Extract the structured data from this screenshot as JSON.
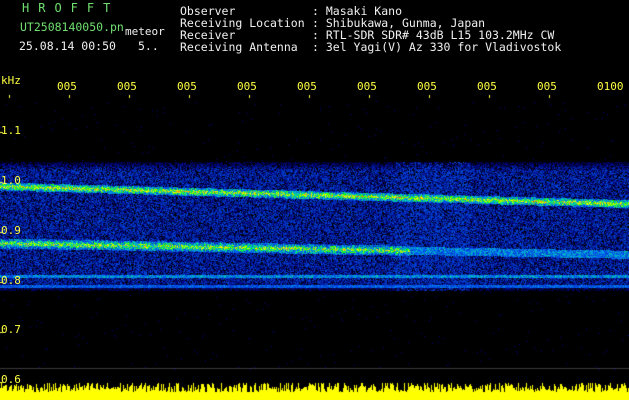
{
  "brand": "HROFFT",
  "file": {
    "name": "UT2508140050.pn",
    "tag": "meteor",
    "datetime": "25.08.14 00:50",
    "counter": "5.."
  },
  "header": {
    "labels": [
      "Observer",
      "Receiving Location",
      "Receiver",
      "Receiving Antenna"
    ],
    "values": [
      ": Masaki Kano",
      ": Shibukawa, Gunma, Japan",
      ": RTL-SDR SDR# 43dB L15 103.2MHz CW",
      ": 3el Yagi(V) Az 330 for Vladivostok"
    ]
  },
  "axis": {
    "unit": "kHz",
    "y_labels": [
      "1.1",
      "1.0",
      "0.9",
      "0.8",
      "0.7",
      "0.6"
    ],
    "x_labels": [
      "005",
      "005",
      "005",
      "005",
      "005",
      "005",
      "005",
      "005",
      "005",
      "0100"
    ]
  },
  "colors": {
    "background": "#000000",
    "label_yellow": "#ffff40",
    "text_white": "#f0f0f0",
    "brand_green": "#6fe06f",
    "signal_blue": "#1a3cff",
    "signal_red": "#ff2020"
  }
}
